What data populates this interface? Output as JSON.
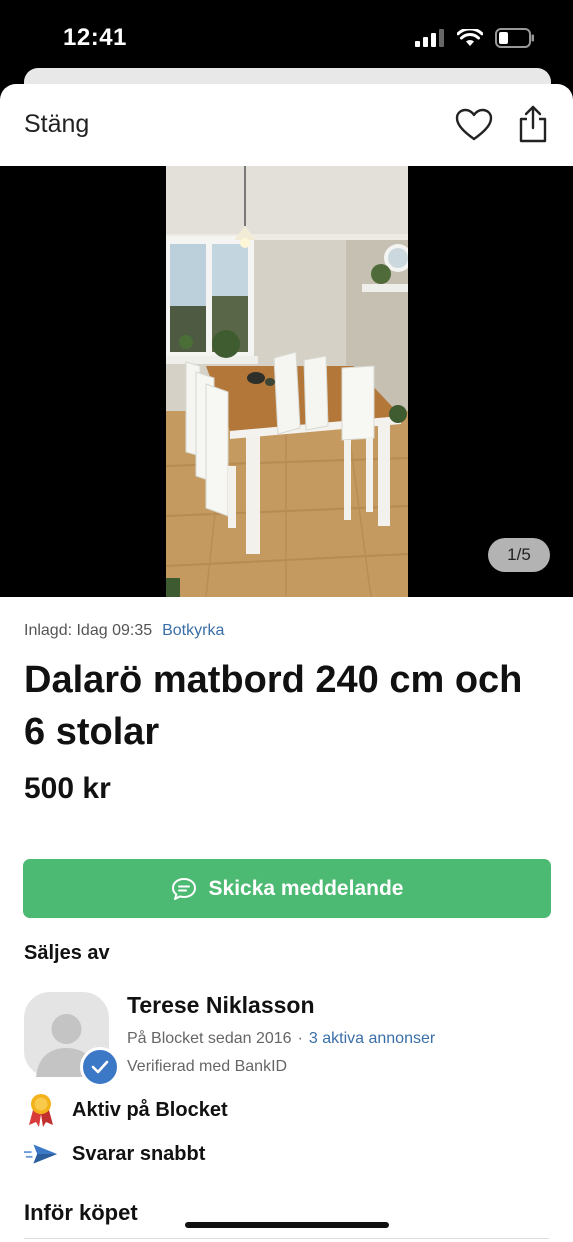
{
  "status_bar": {
    "time": "12:41"
  },
  "header": {
    "close_label": "Stäng"
  },
  "gallery": {
    "counter": "1/5"
  },
  "listing": {
    "posted": "Inlagd: Idag 09:35",
    "location": "Botkyrka",
    "title": "Dalarö matbord 240 cm och 6 stolar",
    "price": "500 kr"
  },
  "actions": {
    "message_label": "Skicka meddelande"
  },
  "seller": {
    "section_title": "Säljes av",
    "name": "Terese Niklasson",
    "since": "På Blocket sedan 2016",
    "separator": "·",
    "active_ads": "3 aktiva annonser",
    "verified": "Verifierad med BankID",
    "traits": [
      {
        "icon": "medal-icon",
        "label": "Aktiv på Blocket"
      },
      {
        "icon": "paper-plane-icon",
        "label": "Svarar snabbt"
      }
    ]
  },
  "before_purchase": {
    "title": "Inför köpet"
  },
  "colors": {
    "accent_green": "#4cba72",
    "link_blue": "#3a6fa8",
    "badge_blue": "#3b78c6"
  }
}
